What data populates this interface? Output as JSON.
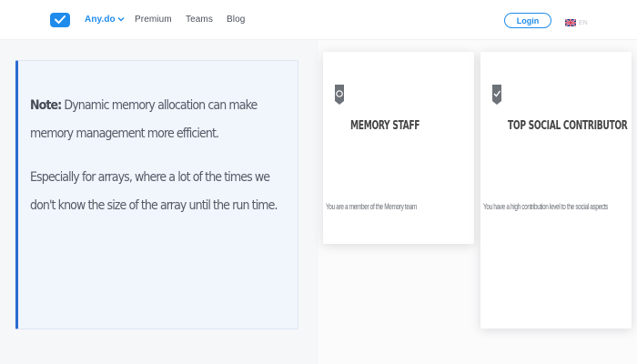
{
  "nav": {
    "brand": "Any.do",
    "links": [
      "Premium",
      "Teams",
      "Blog"
    ],
    "login": "Login",
    "language": "EN"
  },
  "note": {
    "label": "Note:",
    "text1": " Dynamic memory allocation can make memory management more efficient.",
    "text2": "Especially for arrays, where a lot of the times we don't know the size of the array until the run time."
  },
  "badges": [
    {
      "title": "MEMORY STAFF",
      "description": "You are a member of the Memory team"
    },
    {
      "title": "TOP SOCIAL CONTRIBUTOR",
      "description": "You have a high contribution level to the social aspects"
    }
  ],
  "colors": {
    "accent": "#1f8ceb",
    "note_border": "#2d6bd0"
  },
  "icons": [
    "check-icon",
    "chevron-down-icon",
    "uk-flag-icon",
    "memory-badge-icon",
    "social-badge-icon"
  ]
}
